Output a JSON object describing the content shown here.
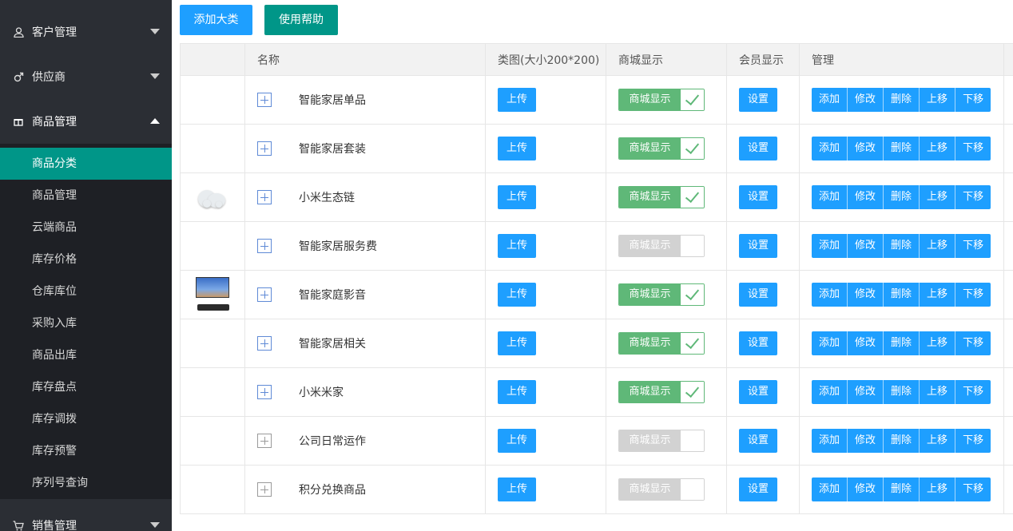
{
  "sidebar": {
    "groups": [
      {
        "label": "客户管理",
        "icon": "user-icon"
      },
      {
        "label": "供应商",
        "icon": "male-icon"
      },
      {
        "label": "商品管理",
        "icon": "gift-icon"
      },
      {
        "label": "销售管理",
        "icon": "cart-icon"
      }
    ],
    "sub_items": [
      "商品分类",
      "商品管理",
      "云端商品",
      "库存价格",
      "仓库库位",
      "采购入库",
      "商品出库",
      "库存盘点",
      "库存调拨",
      "库存预警",
      "序列号查询"
    ]
  },
  "toolbar": {
    "add_category_label": "添加大类",
    "help_label": "使用帮助"
  },
  "table": {
    "headers": [
      "",
      "名称",
      "类图(大小200*200)",
      "商城显示",
      "会员显示",
      "管理"
    ],
    "upload_label": "上传",
    "switch_label": "商城显示",
    "settings_label": "设置",
    "actions": [
      "添加",
      "修改",
      "删除",
      "上移",
      "下移"
    ],
    "rows": [
      {
        "name": "智能家居单品",
        "mall_display": true,
        "image": "",
        "expandable_active": true
      },
      {
        "name": "智能家居套装",
        "mall_display": true,
        "image": "",
        "expandable_active": true
      },
      {
        "name": "小米生态链",
        "mall_display": true,
        "image": "cloud-thumbnail",
        "expandable_active": true
      },
      {
        "name": "智能家居服务费",
        "mall_display": false,
        "image": "",
        "expandable_active": true
      },
      {
        "name": "智能家庭影音",
        "mall_display": true,
        "image": "tv-thumbnail",
        "expandable_active": true
      },
      {
        "name": "智能家居相关",
        "mall_display": true,
        "image": "",
        "expandable_active": true
      },
      {
        "name": "小米米家",
        "mall_display": true,
        "image": "",
        "expandable_active": true
      },
      {
        "name": "公司日常运作",
        "mall_display": false,
        "image": "",
        "expandable_active": false
      },
      {
        "name": "积分兑换商品",
        "mall_display": false,
        "image": "",
        "expandable_active": false
      }
    ]
  },
  "colors": {
    "sidebar_bg": "#2b2e34",
    "active_item": "#009688",
    "primary_button": "#1e9fff",
    "switch_on": "#5fb878",
    "switch_off": "#d2d2d2"
  }
}
